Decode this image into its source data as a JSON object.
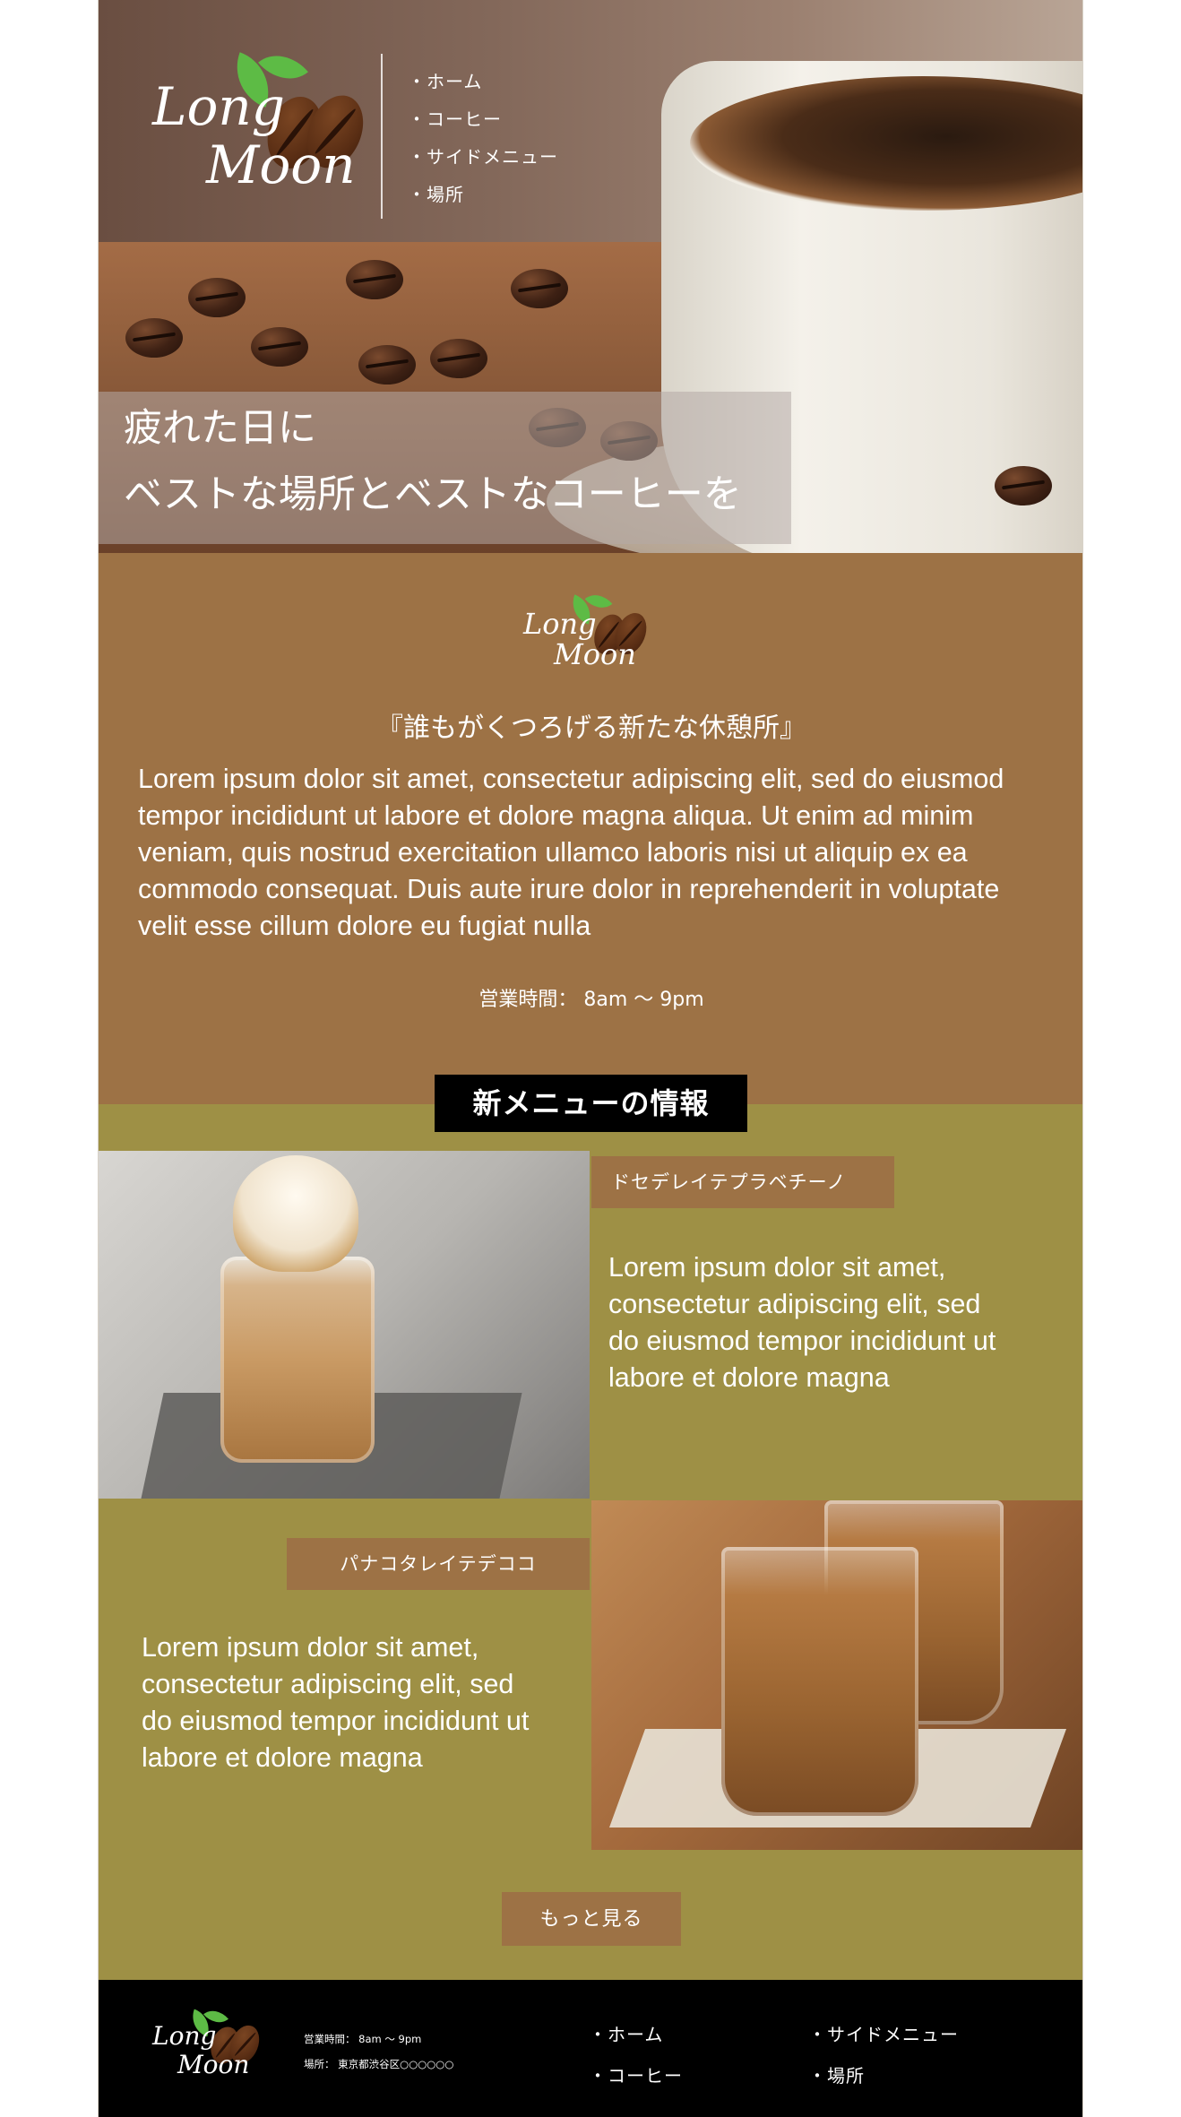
{
  "brand": {
    "logo_line1": "Long",
    "logo_line2": "Moon"
  },
  "nav": {
    "items": [
      "ホーム",
      "コーヒー",
      "サイドメニュー",
      "場所"
    ]
  },
  "hero": {
    "caption_line1": "疲れた日に",
    "caption_line2": "ベストな場所とベストなコーヒーを"
  },
  "intro": {
    "tagline": "『誰もがくつろげる新たな休憩所』",
    "body": "Lorem ipsum dolor sit amet, consectetur adipiscing elit, sed do eiusmod tempor incididunt ut labore et dolore magna aliqua. Ut enim ad minim veniam, quis nostrud exercitation ullamco laboris nisi ut aliquip ex ea commodo consequat. Duis aute irure dolor in reprehenderit in voluptate velit esse cillum dolore eu fugiat nulla",
    "hours": "営業時間： 8am 〜 9pm"
  },
  "menu": {
    "title": "新メニューの情報",
    "items": [
      {
        "name": "ドセデレイテプラベチーノ",
        "description": "Lorem ipsum dolor sit amet, consectetur adipiscing elit, sed do eiusmod tempor incididunt ut labore et dolore magna"
      },
      {
        "name": "パナコタレイテデココ",
        "description": "Lorem ipsum dolor sit amet, consectetur adipiscing elit, sed do eiusmod tempor incididunt ut labore et dolore magna"
      }
    ],
    "more_label": "もっと見る"
  },
  "footer": {
    "hours": "営業時間： 8am 〜 9pm",
    "address": "場所： 東京都渋谷区○○○○○○"
  },
  "colors": {
    "brown": "#9d7245",
    "olive": "#9e9045",
    "black": "#000000",
    "leaf_green": "#5dbb45",
    "bean_brown": "#5a2e14"
  }
}
